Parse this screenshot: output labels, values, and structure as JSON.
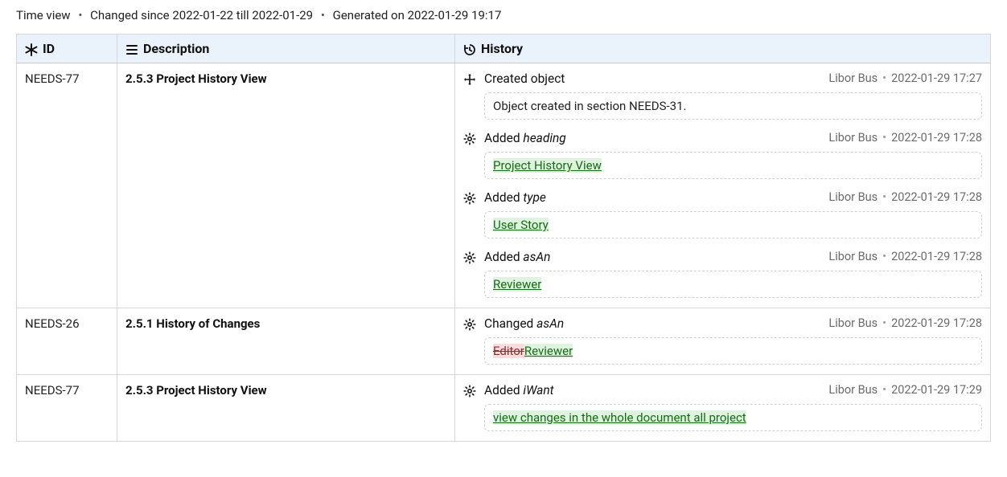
{
  "breadcrumb": {
    "view": "Time view",
    "changed": "Changed since 2022-01-22 till 2022-01-29",
    "generated": "Generated on 2022-01-29 19:17"
  },
  "columns": {
    "id": "ID",
    "description": "Description",
    "history": "History"
  },
  "icons": {
    "id_header": "asterisk",
    "desc_header": "list-lines",
    "hist_header": "history",
    "created": "move-arrows",
    "changed": "gear"
  },
  "rows": [
    {
      "id": "NEEDS-77",
      "description": "2.5.3 Project History View",
      "history": [
        {
          "icon": "created",
          "action": "Created object",
          "field": "",
          "author": "Libor Bus",
          "time": "2022-01-29 17:27",
          "body": {
            "plain": "Object created in section NEEDS-31."
          }
        },
        {
          "icon": "changed",
          "action": "Added",
          "field": "heading",
          "author": "Libor Bus",
          "time": "2022-01-29 17:28",
          "body": {
            "ins": "Project History View"
          }
        },
        {
          "icon": "changed",
          "action": "Added",
          "field": "type",
          "author": "Libor Bus",
          "time": "2022-01-29 17:28",
          "body": {
            "ins": "User Story"
          }
        },
        {
          "icon": "changed",
          "action": "Added",
          "field": "asAn",
          "author": "Libor Bus",
          "time": "2022-01-29 17:28",
          "body": {
            "ins": "Reviewer"
          }
        }
      ]
    },
    {
      "id": "NEEDS-26",
      "description": "2.5.1 History of Changes",
      "history": [
        {
          "icon": "changed",
          "action": "Changed",
          "field": "asAn",
          "author": "Libor Bus",
          "time": "2022-01-29 17:28",
          "body": {
            "del": "Editor",
            "ins": "Reviewer"
          }
        }
      ]
    },
    {
      "id": "NEEDS-77",
      "description": "2.5.3 Project History View",
      "history": [
        {
          "icon": "changed",
          "action": "Added",
          "field": "iWant",
          "author": "Libor Bus",
          "time": "2022-01-29 17:29",
          "body": {
            "ins": "view changes in the whole document all project"
          }
        }
      ]
    }
  ]
}
